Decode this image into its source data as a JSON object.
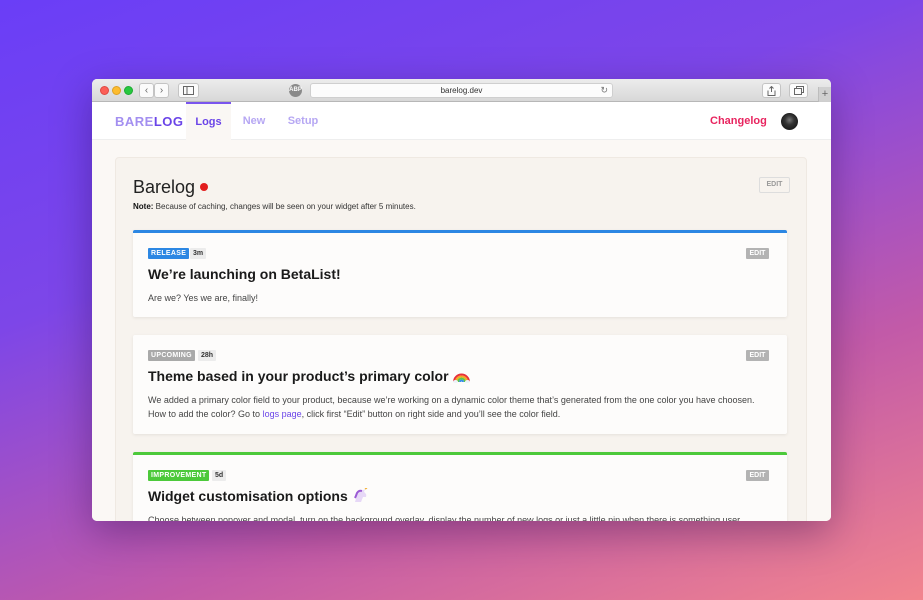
{
  "browser": {
    "url": "barelog.dev"
  },
  "app": {
    "logo_bare": "BARE",
    "logo_log": "LOG",
    "tabs": [
      {
        "label": "Logs"
      },
      {
        "label": "New"
      },
      {
        "label": "Setup"
      }
    ],
    "changelog_link": "Changelog"
  },
  "page": {
    "title": "Barelog",
    "edit_label": "EDIT",
    "note_label": "Note:",
    "note_text": " Because of caching, changes will be seen on your widget after 5 minutes."
  },
  "logs": [
    {
      "badge": "RELEASE",
      "badge_color": "#2c87e3",
      "time": "3m",
      "edit": "EDIT",
      "title": "We’re launching on BetaList!",
      "body": "Are we? Yes we are, finally!"
    },
    {
      "badge": "UPCOMING",
      "badge_color": "#a9a9a9",
      "time": "28h",
      "edit": "EDIT",
      "title": "Theme based in your product’s primary color",
      "title_icon": "rainbow-icon",
      "body_before_link": "We added a primary color field to your product, because we’re working on a dynamic color theme that’s generated from the one color you have choosen. How to add the color? Go to ",
      "body_link": "logs page",
      "body_after_link": ", click first “Edit” button on right side and you’ll see the color field."
    },
    {
      "badge": "IMPROVEMENT",
      "badge_color": "#4cc93a",
      "time": "5d",
      "edit": "EDIT",
      "title": "Widget customisation options",
      "title_icon": "unicorn-icon",
      "body": "Choose between popover and modal, turn on the background overlay, display the number of new logs or just a little pin when there is something user"
    }
  ],
  "colors": {
    "brand": "#6a44e8",
    "changelog": "#e8245f",
    "live_dot": "#e21d1d"
  }
}
